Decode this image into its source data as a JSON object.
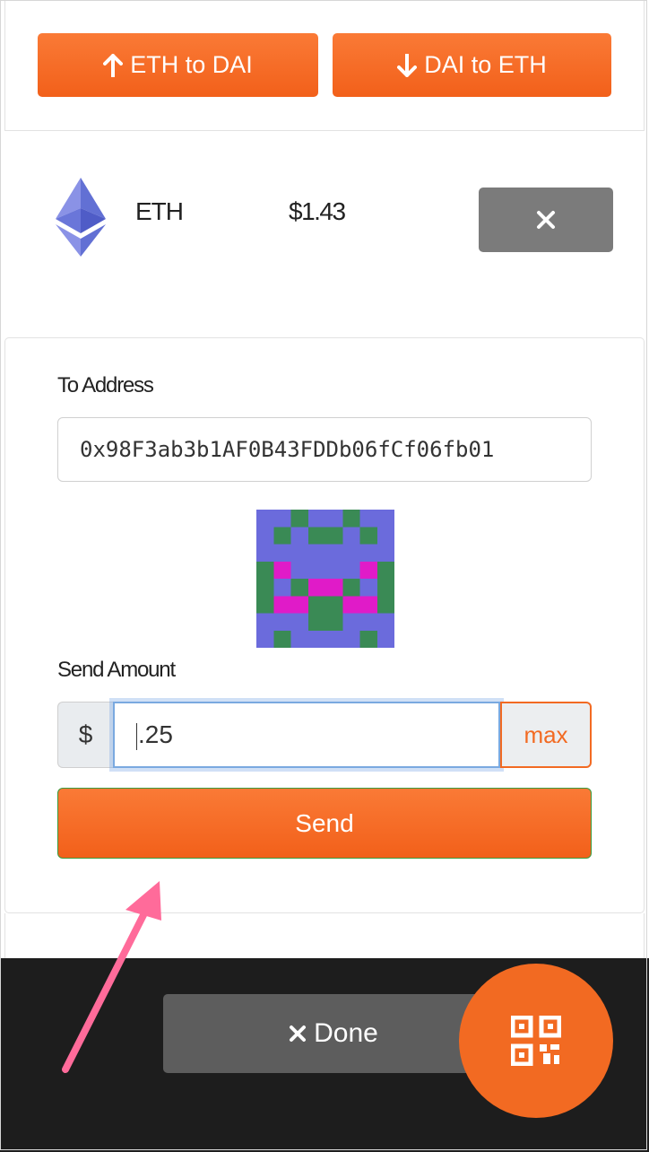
{
  "swap": {
    "eth_to_dai_label": "ETH to DAI",
    "dai_to_eth_label": "DAI to ETH"
  },
  "token": {
    "symbol": "ETH",
    "balance": "$1.43"
  },
  "send_form": {
    "to_address_label": "To Address",
    "to_address_value": "0x98F3ab3b1AF0B43FDDb06fCf06fb01",
    "send_amount_label": "Send Amount",
    "currency_symbol": "$",
    "amount_value": ".25",
    "max_label": "max",
    "send_label": "Send"
  },
  "footer": {
    "done_label": "Done"
  },
  "icons": {
    "up": "arrow-up-icon",
    "down": "arrow-down-icon",
    "close": "close-icon",
    "qr": "qr-code-icon"
  },
  "colors": {
    "accent": "#f26a22",
    "close_button": "#7b7b7b",
    "footer_bg": "#1d1d1d",
    "done_button": "#5d5d5d",
    "annotation_arrow": "#ff6b9a"
  }
}
